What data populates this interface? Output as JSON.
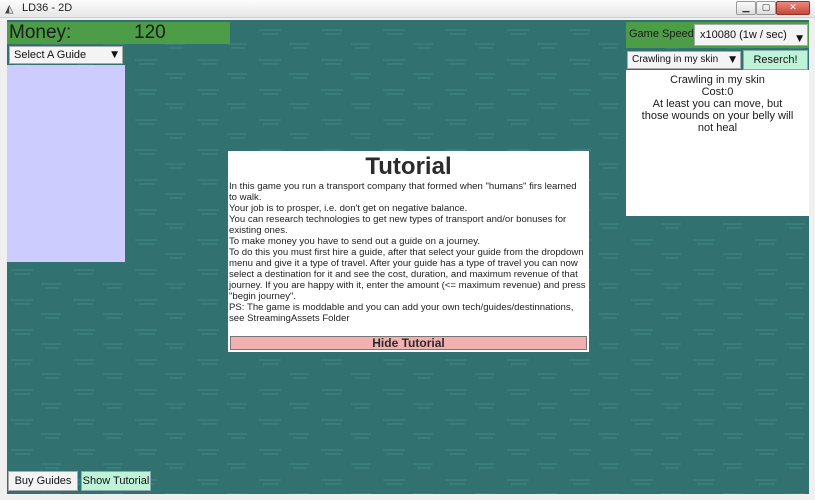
{
  "window": {
    "title": "LD36 - 2D",
    "icon": "unity-icon"
  },
  "money": {
    "label": "Money:",
    "value": "120"
  },
  "guide_select": {
    "selected": "Select A Guide"
  },
  "speed": {
    "label": "Game Speed:",
    "selected": "x10080 (1w / sec)"
  },
  "tech": {
    "selected": "Crawling in my skin",
    "research_label": "Reserch!",
    "name": "Crawling in my skin",
    "cost": "Cost:0",
    "description": "At least you can move, but those wounds on your belly will not heal"
  },
  "tutorial": {
    "title": "Tutorial",
    "paragraphs": [
      "In this game you run a transport company that formed when \"humans\" firs learned to walk.",
      "Your job is to prosper, i.e. don't get on negative balance.",
      "You can research technologies to get new types of transport and/or bonuses for existing ones.",
      "To make money you have to send out a guide on a journey.",
      "To do this you must first hire a guide, after that select your guide from the dropdown menu and give it a type of travel. After your guide has a type of travel you can now select a destination for it and see the cost, duration, and maximum revenue of that journey. If you are happy with it, enter the amount (<= maximum revenue) and press \"begin journey\".",
      "PS: The game is moddable and you can add your own tech/guides/destinnations, see StreamingAssets Folder"
    ],
    "hide_label": "Hide Tutorial"
  },
  "bottom": {
    "buy_label": "Buy Guides",
    "show_label": "Show Tutorial"
  },
  "colors": {
    "background": "#317170",
    "money_bar": "#4d9c47",
    "guide_panel": "#ccccff",
    "accent_button": "#bff3d8",
    "hide_button": "#f2b0b0"
  }
}
